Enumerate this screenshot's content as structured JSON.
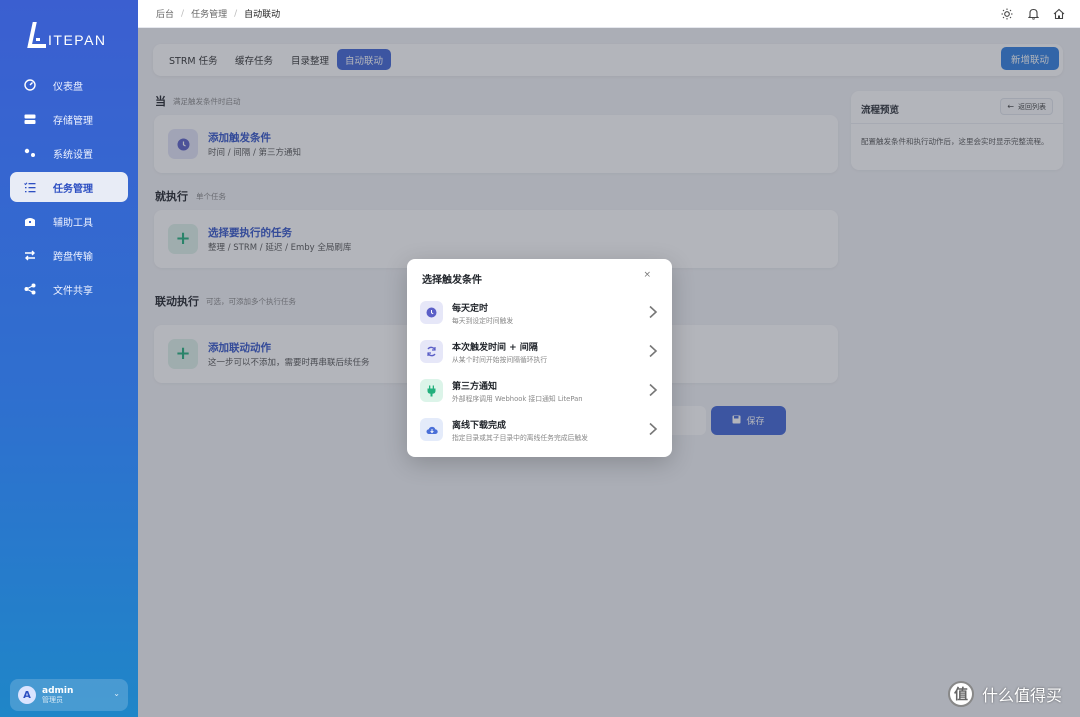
{
  "app": {
    "logo_text": "ITEPAN"
  },
  "sidebar": {
    "items": [
      {
        "label": "仪表盘",
        "icon": "dashboard-icon"
      },
      {
        "label": "存储管理",
        "icon": "storage-icon"
      },
      {
        "label": "系统设置",
        "icon": "settings-icon"
      },
      {
        "label": "任务管理",
        "icon": "task-list-icon",
        "active": true
      },
      {
        "label": "辅助工具",
        "icon": "toolbox-icon"
      },
      {
        "label": "跨盘传输",
        "icon": "transfer-icon"
      },
      {
        "label": "文件共享",
        "icon": "share-icon"
      }
    ],
    "user": {
      "avatar": "A",
      "name": "admin",
      "role": "管理员"
    }
  },
  "breadcrumb": [
    "后台",
    "任务管理",
    "自动联动"
  ],
  "tabs": {
    "items": [
      "STRM 任务",
      "缓存任务",
      "目录整理",
      "自动联动"
    ],
    "active": "自动联动",
    "new_button": "新增联动"
  },
  "sections": {
    "when": {
      "title": "当",
      "sub": "满足触发条件时启动"
    },
    "then": {
      "title": "就执行",
      "sub": "单个任务"
    },
    "linked": {
      "title": "联动执行",
      "sub": "可选，可添加多个执行任务"
    }
  },
  "cards": {
    "trigger": {
      "title": "添加触发条件",
      "sub": "时间 / 间隔 / 第三方通知"
    },
    "task": {
      "title": "选择要执行的任务",
      "sub": "整理 / STRM / 延迟 / Emby 全局刷库"
    },
    "action": {
      "title": "添加联动动作",
      "sub": "这一步可以不添加，需要时再串联后续任务"
    }
  },
  "save_button": "保存",
  "preview": {
    "title": "流程预览",
    "back_button": "返回列表",
    "text": "配置触发条件和执行动作后，这里会实时显示完整流程。"
  },
  "modal": {
    "title": "选择触发条件",
    "close": "×",
    "options": [
      {
        "title": "每天定时",
        "sub": "每天到设定时间触发",
        "icon": "clock-icon",
        "color": "#5b5fc7"
      },
      {
        "title": "本次触发时间 + 间隔",
        "sub": "从某个时间开始按间隔循环执行",
        "icon": "refresh-icon",
        "color": "#5b5fc7"
      },
      {
        "title": "第三方通知",
        "sub": "外部程序调用 Webhook 接口通知 LitePan",
        "icon": "plug-icon",
        "color": "#22b07d"
      },
      {
        "title": "离线下载完成",
        "sub": "指定目录或其子目录中的离线任务完成后触发",
        "icon": "cloud-download-icon",
        "color": "#4a6fd8"
      }
    ]
  },
  "watermark": {
    "logo": "值",
    "text": "什么值得买"
  },
  "colors": {
    "accent": "#3f64d6",
    "sidebar_top": "#3b5fd0",
    "sidebar_bottom": "#1f86c8",
    "green": "#22b07d"
  }
}
